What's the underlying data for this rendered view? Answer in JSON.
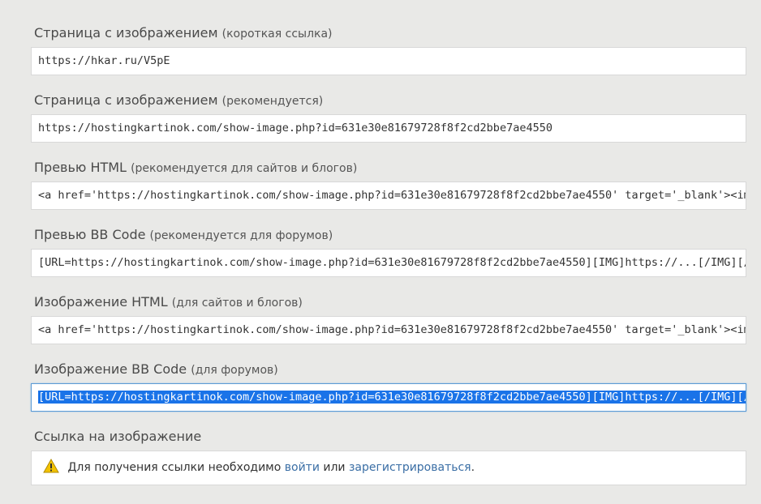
{
  "groups": [
    {
      "title": "Страница с изображением",
      "hint": "(короткая ссылка)",
      "value": "https://hkar.ru/V5pE",
      "selected": false
    },
    {
      "title": "Страница с изображением",
      "hint": "(рекомендуется)",
      "value": "https://hostingkartinok.com/show-image.php?id=631e30e81679728f8f2cd2bbe7ae4550",
      "selected": false
    },
    {
      "title": "Превью HTML",
      "hint": "(рекомендуется для сайтов и блогов)",
      "value": "<a href='https://hostingkartinok.com/show-image.php?id=631e30e81679728f8f2cd2bbe7ae4550' target='_blank'><img src='...'></a>",
      "selected": false
    },
    {
      "title": "Превью BB Code",
      "hint": "(рекомендуется для форумов)",
      "value": "[URL=https://hostingkartinok.com/show-image.php?id=631e30e81679728f8f2cd2bbe7ae4550][IMG]https://...[/IMG][/URL]",
      "selected": false
    },
    {
      "title": "Изображение HTML",
      "hint": "(для сайтов и блогов)",
      "value": "<a href='https://hostingkartinok.com/show-image.php?id=631e30e81679728f8f2cd2bbe7ae4550' target='_blank'><img src='...'></a>",
      "selected": false
    },
    {
      "title": "Изображение BB Code",
      "hint": "(для форумов)",
      "value": "[URL=https://hostingkartinok.com/show-image.php?id=631e30e81679728f8f2cd2bbe7ae4550][IMG]https://...[/IMG][/URL]",
      "selected": true
    }
  ],
  "image_link": {
    "title": "Ссылка на изображение",
    "notice_text": "Для получения ссылки необходимо",
    "login_link": "войти",
    "or_text": "или",
    "register_link": "зарегистрироваться",
    "period": "."
  },
  "colors": {
    "link": "#3a6ea5",
    "selection": "#1a73e8",
    "warning": "#f2c200"
  }
}
